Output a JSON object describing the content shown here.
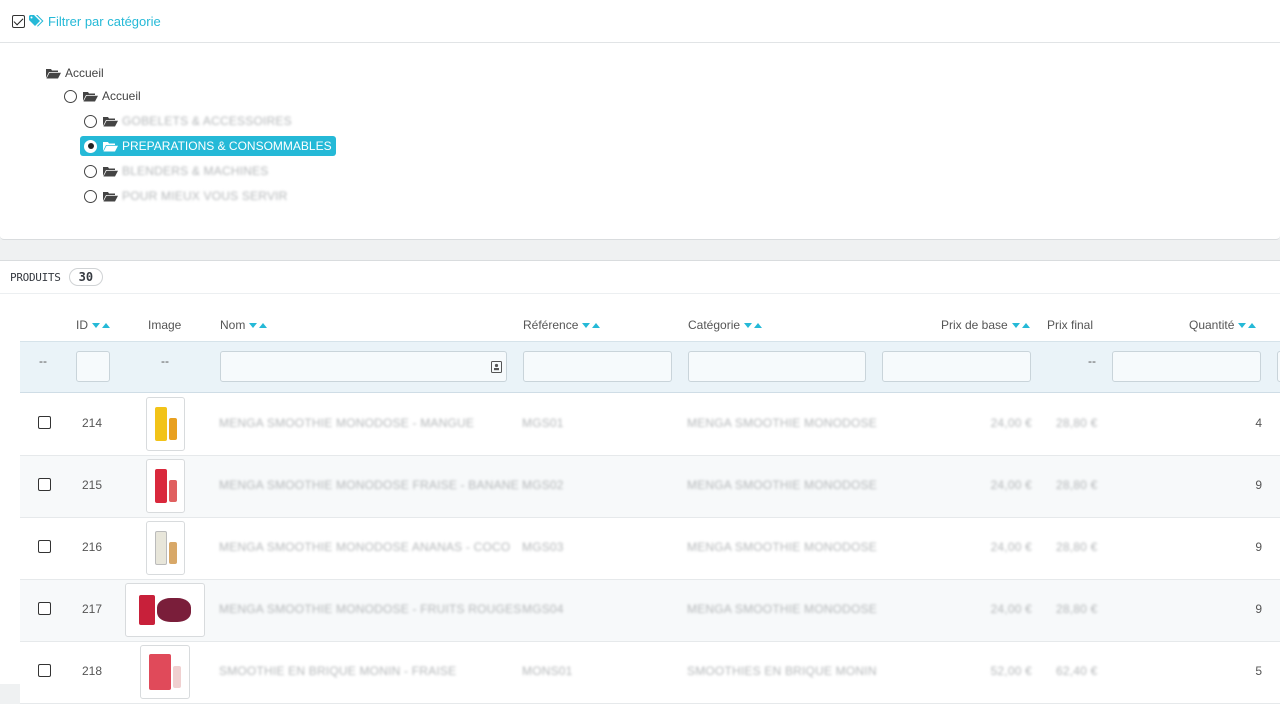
{
  "filter": {
    "link_label": "Filtrer par catégorie"
  },
  "tree": {
    "root_label": "Accueil",
    "home_label": "Accueil",
    "categories": [
      {
        "label": "GOBELETS & ACCESSOIRES",
        "selected": false
      },
      {
        "label": "PREPARATIONS & CONSOMMABLES",
        "selected": true
      },
      {
        "label": "BLENDERS & MACHINES",
        "selected": false
      },
      {
        "label": "POUR MIEUX VOUS SERVIR",
        "selected": false
      }
    ]
  },
  "products": {
    "title": "PRODUITS",
    "count": "30",
    "columns": {
      "id": "ID",
      "image": "Image",
      "name": "Nom",
      "reference": "Référence",
      "category": "Catégorie",
      "base_price": "Prix de base",
      "final_price": "Prix final",
      "quantity": "Quantité"
    },
    "filter_placeholders": {
      "bulk": "--",
      "image": "--",
      "final_price": "--"
    },
    "rows": [
      {
        "id": "214",
        "name": "MENGA SMOOTHIE MONODOSE - MANGUE",
        "reference": "MGS01",
        "category": "MENGA SMOOTHIE MONODOSE",
        "base_price": "24,00 €",
        "final_price": "28,80 €",
        "quantity": "4",
        "thumb_colors": [
          "#f2c318",
          "#e8a020"
        ]
      },
      {
        "id": "215",
        "name": "MENGA SMOOTHIE MONODOSE FRAISE - BANANE",
        "reference": "MGS02",
        "category": "MENGA SMOOTHIE MONODOSE",
        "base_price": "24,00 €",
        "final_price": "28,80 €",
        "quantity": "9",
        "thumb_colors": [
          "#d9283c",
          "#e06060"
        ]
      },
      {
        "id": "216",
        "name": "MENGA SMOOTHIE MONODOSE ANANAS - COCO",
        "reference": "MGS03",
        "category": "MENGA SMOOTHIE MONODOSE",
        "base_price": "24,00 €",
        "final_price": "28,80 €",
        "quantity": "9",
        "thumb_colors": [
          "#e8e6da",
          "#d8a868"
        ]
      },
      {
        "id": "217",
        "name": "MENGA SMOOTHIE MONODOSE - FRUITS ROUGES",
        "reference": "MGS04",
        "category": "MENGA SMOOTHIE MONODOSE",
        "base_price": "24,00 €",
        "final_price": "28,80 €",
        "quantity": "9",
        "thumb_colors": [
          "#c8203a",
          "#7a1e3a"
        ]
      },
      {
        "id": "218",
        "name": "SMOOTHIE EN BRIQUE MONIN - FRAISE",
        "reference": "MONS01",
        "category": "SMOOTHIES EN BRIQUE MONIN",
        "base_price": "52,00 €",
        "final_price": "62,40 €",
        "quantity": "5",
        "thumb_colors": [
          "#e04a5a",
          "#f0d0d0"
        ]
      }
    ]
  },
  "colors": {
    "accent": "#25b9d7",
    "filter_row_bg": "#eaf3f8"
  },
  "icons": {
    "filter_tag": "tags-icon",
    "folder": "folder-open-icon",
    "sort_down": "caret-down-icon",
    "sort_up": "caret-up-icon",
    "name_filter": "contact-card-icon"
  }
}
